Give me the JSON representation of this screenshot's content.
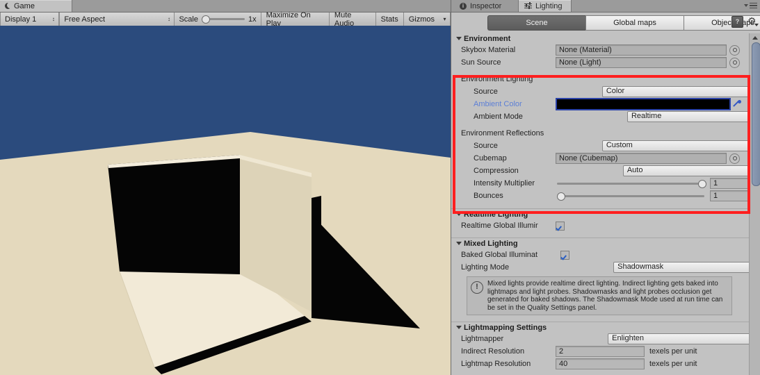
{
  "game_panel": {
    "tab_label": "Game",
    "tab_icon": "moon-icon",
    "toolbar": {
      "display": "Display 1",
      "aspect": "Free Aspect",
      "scale_label": "Scale",
      "scale_value": "1x",
      "maximize_on_play": "Maximize On Play",
      "mute_audio": "Mute Audio",
      "stats": "Stats",
      "gizmos": "Gizmos"
    },
    "scene_colors": {
      "sky": "#2b4b7d",
      "ground": "#e4d9bd",
      "wall_lit": "#efe7d2",
      "wall_mid": "#d9cfb4",
      "shadow": "#050505"
    }
  },
  "inspector": {
    "tabs": [
      {
        "label": "Inspector",
        "icon": "info-circle-icon",
        "active": false
      },
      {
        "label": "Lighting",
        "icon": "lighting-sliders-icon",
        "active": true
      }
    ],
    "menu_icon": "hamburger-menu-icon",
    "mode_buttons": [
      {
        "label": "Scene",
        "active": true
      },
      {
        "label": "Global maps",
        "active": false
      },
      {
        "label": "Object maps",
        "active": false
      }
    ],
    "help_icon": "help-book-icon",
    "settings_icon": "gear-icon"
  },
  "sections": {
    "environment": {
      "title": "Environment",
      "skybox_material": {
        "label": "Skybox Material",
        "value": "None (Material)"
      },
      "sun_source": {
        "label": "Sun Source",
        "value": "None (Light)"
      }
    },
    "environment_lighting": {
      "title": "Environment Lighting",
      "source": {
        "label": "Source",
        "value": "Color"
      },
      "ambient_color": {
        "label": "Ambient Color",
        "value": "#000000",
        "label_color": "#5c7fd6"
      },
      "ambient_mode": {
        "label": "Ambient Mode",
        "value": "Realtime"
      }
    },
    "environment_reflections": {
      "title": "Environment Reflections",
      "source": {
        "label": "Source",
        "value": "Custom"
      },
      "cubemap": {
        "label": "Cubemap",
        "value": "None (Cubemap)"
      },
      "compression": {
        "label": "Compression",
        "value": "Auto"
      },
      "intensity_multiplier": {
        "label": "Intensity Multiplier",
        "value": "1",
        "slider_pct": 100
      },
      "bounces": {
        "label": "Bounces",
        "value": "1",
        "slider_pct": 0
      }
    },
    "realtime_lighting": {
      "title": "Realtime Lighting",
      "realtime_gi": {
        "label": "Realtime Global Illumir",
        "checked": true
      }
    },
    "mixed_lighting": {
      "title": "Mixed Lighting",
      "baked_gi": {
        "label": "Baked Global Illuminat",
        "checked": true
      },
      "lighting_mode": {
        "label": "Lighting Mode",
        "value": "Shadowmask"
      },
      "info": "Mixed lights provide realtime direct lighting. Indirect lighting gets baked into lightmaps and light probes. Shadowmasks and light probes occlusion get generated for baked shadows. The Shadowmask Mode used at run time can be set in the Quality Settings panel.",
      "info_icon": "warning-exclamation-icon"
    },
    "lightmapping_settings": {
      "title": "Lightmapping Settings",
      "lightmapper": {
        "label": "Lightmapper",
        "value": "Enlighten"
      },
      "indirect_resolution": {
        "label": "Indirect Resolution",
        "value": "2",
        "unit": "texels per unit"
      },
      "lightmap_resolution": {
        "label": "Lightmap Resolution",
        "value": "40",
        "unit": "texels per unit"
      }
    }
  },
  "highlight": {
    "color": "#ff1f1f"
  }
}
